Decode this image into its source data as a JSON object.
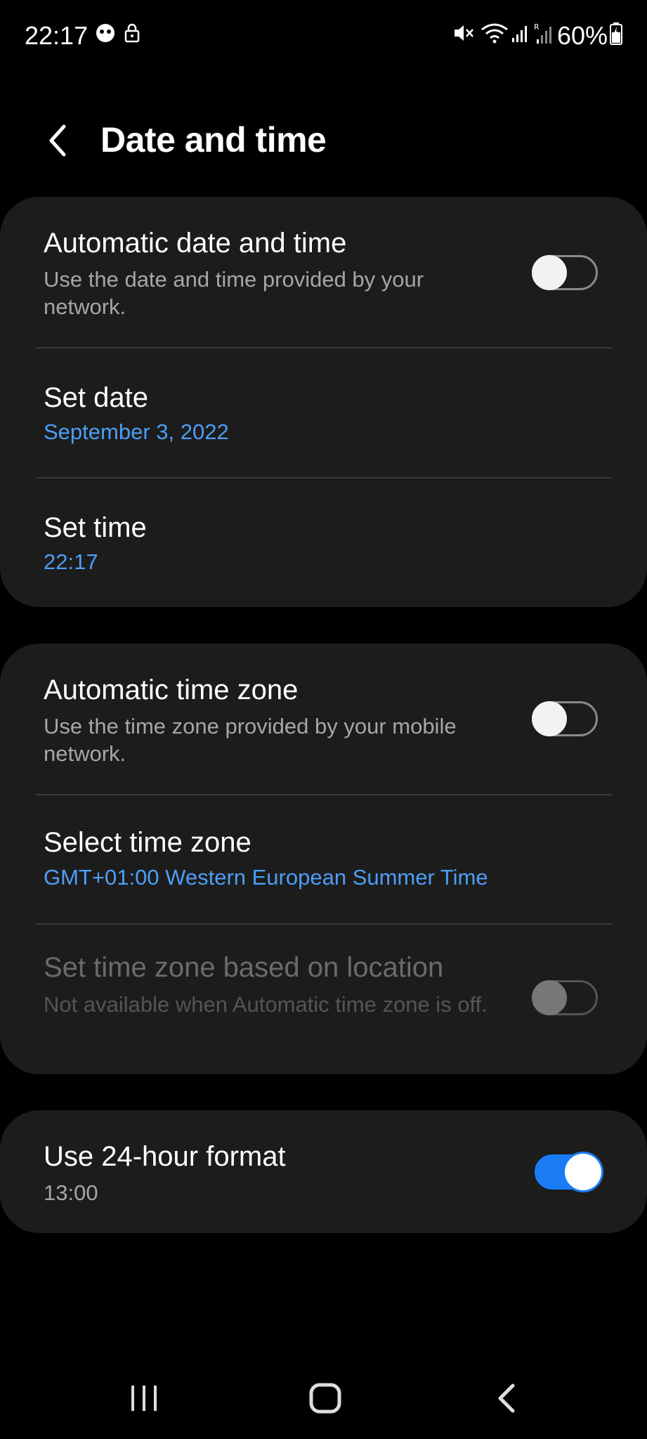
{
  "status_bar": {
    "time": "22:17",
    "battery": "60%",
    "icons": [
      "smiley-notification-icon",
      "lock-icon",
      "mute-icon",
      "wifi-icon",
      "signal-icon",
      "roaming-signal-icon",
      "battery-icon"
    ]
  },
  "header": {
    "title": "Date and time"
  },
  "card1": {
    "automatic_date": {
      "title": "Automatic date and time",
      "subtitle": "Use the date and time provided by your network.",
      "enabled": false
    },
    "set_date": {
      "title": "Set date",
      "value": "September 3, 2022"
    },
    "set_time": {
      "title": "Set time",
      "value": "22:17"
    }
  },
  "card2": {
    "automatic_timezone": {
      "title": "Automatic time zone",
      "subtitle": "Use the time zone provided by your mobile network.",
      "enabled": false
    },
    "select_timezone": {
      "title": "Select time zone",
      "value": "GMT+01:00 Western European Summer Time"
    },
    "timezone_location": {
      "title": "Set time zone based on location",
      "subtitle": "Not available when Automatic time zone is off.",
      "enabled": false,
      "disabled": true
    }
  },
  "card3": {
    "use_24_hour": {
      "title": "Use 24-hour format",
      "subtitle": "13:00",
      "enabled": true
    }
  },
  "colors": {
    "background": "#000000",
    "card": "#1c1c1c",
    "accent": "#4d9ef5",
    "toggle_on": "#1a7cf5"
  }
}
